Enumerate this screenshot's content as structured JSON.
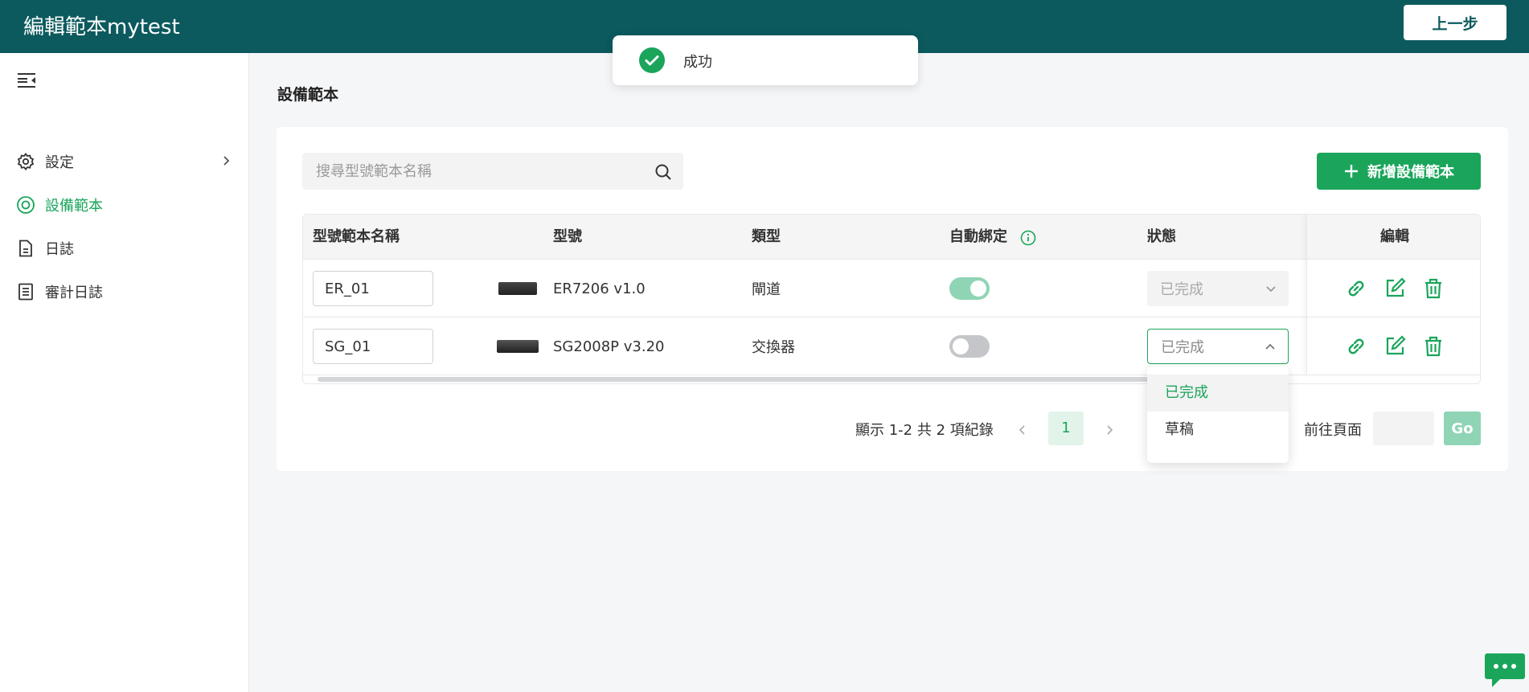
{
  "header": {
    "title": "編輯範本mytest",
    "back_label": "上一步"
  },
  "toast": {
    "message": "成功",
    "icon": "check-circle-icon",
    "color": "#1aa55b"
  },
  "sidebar": {
    "items": [
      {
        "label": "設定",
        "icon": "gear-icon",
        "has_chevron": true,
        "active": false
      },
      {
        "label": "設備範本",
        "icon": "target-icon",
        "active": true
      },
      {
        "label": "日誌",
        "icon": "document-icon",
        "active": false
      },
      {
        "label": "審計日誌",
        "icon": "list-document-icon",
        "active": false
      }
    ]
  },
  "main": {
    "page_title": "設備範本",
    "search": {
      "placeholder": "搜尋型號範本名稱",
      "value": ""
    },
    "add_button_label": "新增設備範本",
    "table": {
      "columns": [
        "型號範本名稱",
        "型號",
        "類型",
        "自動綁定",
        "狀態",
        "編輯"
      ],
      "rows": [
        {
          "name": "ER_01",
          "model": "ER7206 v1.0",
          "type": "閘道",
          "auto_bind": true,
          "status": "已完成",
          "status_state": "disabled"
        },
        {
          "name": "SG_01",
          "model": "SG2008P v3.20",
          "type": "交換器",
          "auto_bind": false,
          "status": "已完成",
          "status_state": "open"
        }
      ]
    },
    "status_dropdown": {
      "options": [
        "已完成",
        "草稿"
      ],
      "selected": "已完成"
    },
    "pagination": {
      "info": "顯示 1-2 共 2 項紀錄",
      "current_page": "1",
      "goto_label": "前往頁面",
      "goto_value": "",
      "go_label": "Go"
    }
  },
  "colors": {
    "header_bg": "#0c5a5e",
    "accent": "#1aa55b",
    "accent_light": "#8fd4b5"
  }
}
